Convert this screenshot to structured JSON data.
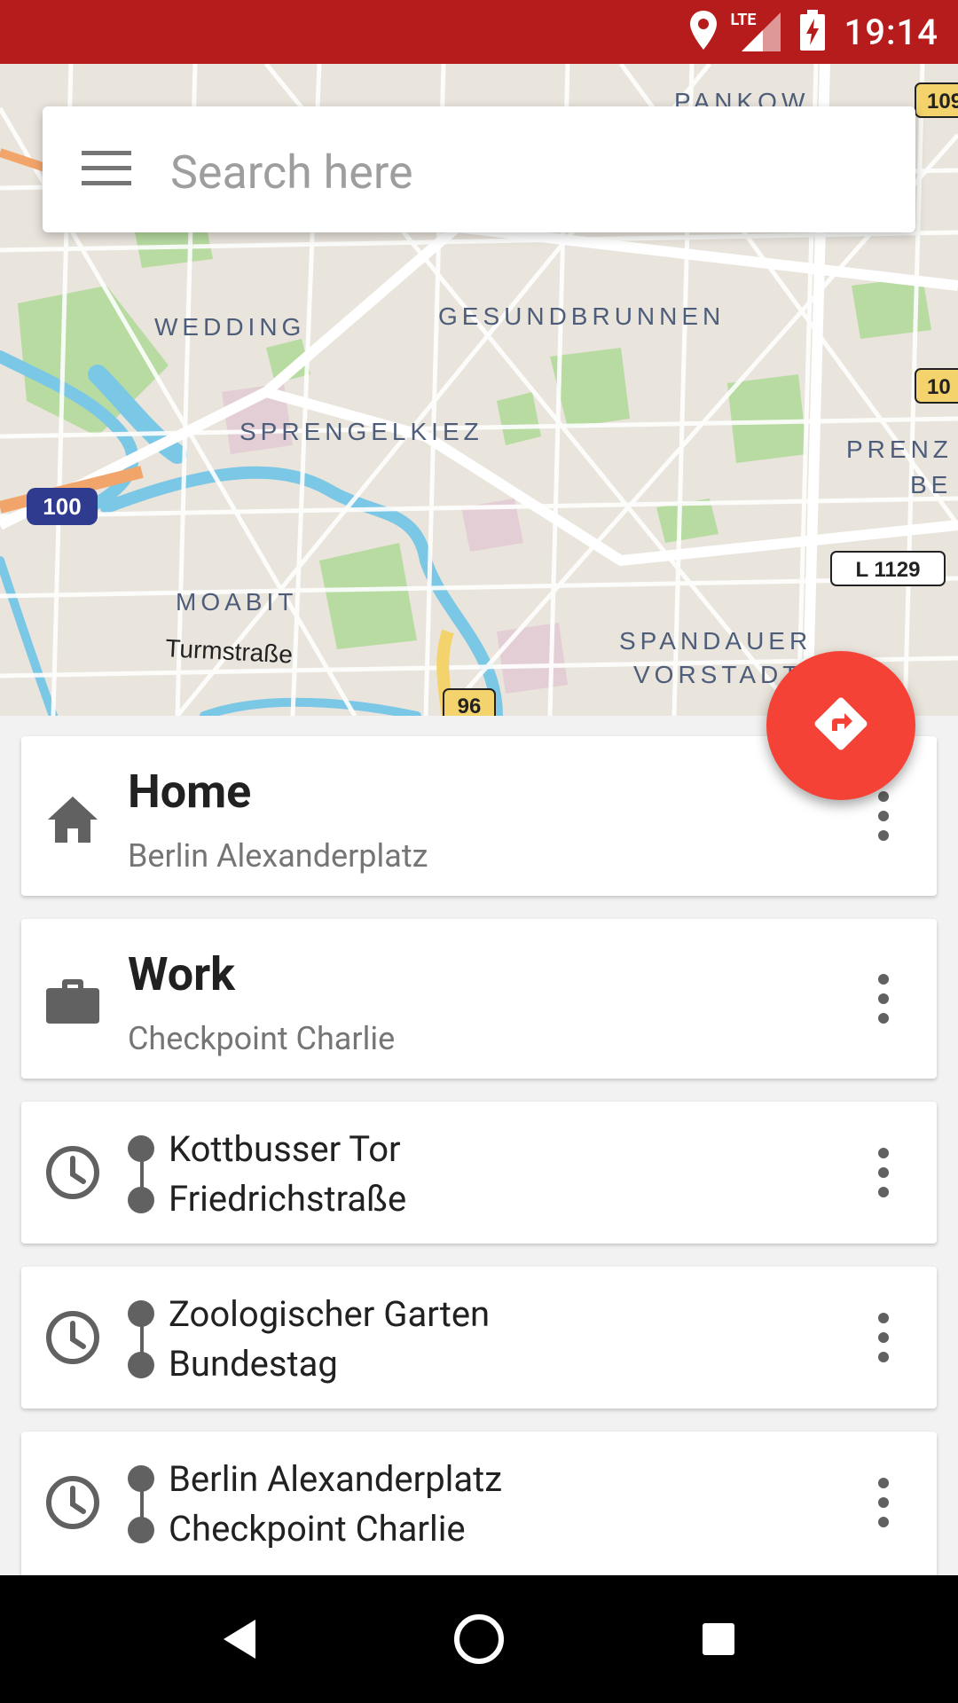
{
  "status_bar": {
    "time": "19:14",
    "network": "LTE",
    "icons": [
      "location-icon",
      "signal-icon",
      "battery-charging-icon"
    ]
  },
  "map": {
    "labels": [
      "PANKOW",
      "WEDDING",
      "GESUNDBRUNNEN",
      "SPRENGELKIEZ",
      "MOABIT",
      "Turmstraße",
      "SPANDAUER",
      "VORSTADT",
      "PRENZ",
      "BE"
    ],
    "road_badges": [
      "100",
      "96",
      "L 1129",
      "109",
      "10"
    ]
  },
  "search": {
    "placeholder": "Search here",
    "menu_icon": "hamburger-menu-icon"
  },
  "fab": {
    "icon": "directions-icon"
  },
  "places": [
    {
      "title": "Home",
      "subtitle": "Berlin Alexanderplatz",
      "icon": "home-icon"
    },
    {
      "title": "Work",
      "subtitle": "Checkpoint Charlie",
      "icon": "briefcase-icon"
    }
  ],
  "recent_routes": [
    {
      "from": "Kottbusser Tor",
      "to": "Friedrichstraße",
      "icon": "clock-icon"
    },
    {
      "from": "Zoologischer Garten",
      "to": "Bundestag",
      "icon": "clock-icon"
    },
    {
      "from": "Berlin Alexanderplatz",
      "to": "Checkpoint Charlie",
      "icon": "clock-icon"
    }
  ],
  "nav_bar": {
    "buttons": [
      "back-icon",
      "home-circle-icon",
      "recents-icon"
    ]
  },
  "colors": {
    "status_bar": "#b71c1c",
    "fab": "#f44336",
    "icon_gray": "#616161"
  }
}
